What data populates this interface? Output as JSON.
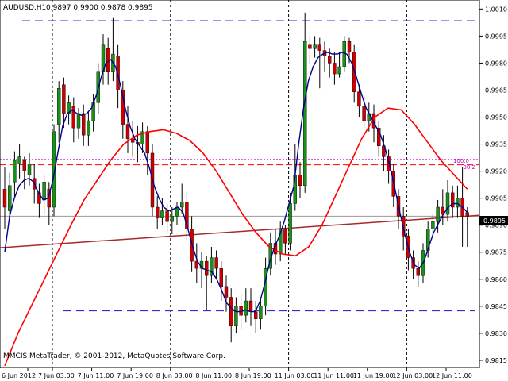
{
  "header": {
    "symbol": "AUDUSD,H1",
    "ohlc": "0.9897 0.9900 0.9878 0.9895"
  },
  "footer": {
    "copyright": "MMCIS MetaTrader, © 2001-2012, MetaQuotes Software Corp."
  },
  "colors": {
    "bull": "#1a8f1a",
    "bear": "#cc0000",
    "wick": "#000000",
    "fast_ma": "#00008b",
    "slow_ma": "#ff0000",
    "trendline": "#a52a2a",
    "channel": "#3333cc",
    "fib": "#cc00cc",
    "level": "#ff0000",
    "bid_line": "#999999",
    "grid": "#000000"
  },
  "chart_data": {
    "type": "candlestick",
    "title": "AUDUSD,H1",
    "ylim": [
      0.9811,
      1.0015
    ],
    "y_ticks": [
      "1.0010",
      "0.9995",
      "0.9980",
      "0.9965",
      "0.9950",
      "0.9935",
      "0.9920",
      "0.9905",
      "0.9890",
      "0.9875",
      "0.9860",
      "0.9845",
      "0.9830",
      "0.9815"
    ],
    "x_ticks": [
      "6 Jun 2012",
      "7 Jun 03:00",
      "7 Jun 11:00",
      "7 Jun 19:00",
      "8 Jun 03:00",
      "8 Jun 11:00",
      "8 Jun 19:00",
      "11 Jun 03:00",
      "11 Jun 11:00",
      "11 Jun 19:00",
      "12 Jun 03:00",
      "12 Jun 11:00"
    ],
    "period_separators": [
      "7 Jun 03:00",
      "8 Jun 03:00",
      "11 Jun 03:00",
      "12 Jun 03:00"
    ],
    "current_price": "0.9895",
    "fibonacci": {
      "level_100": "100.0",
      "level_38": "38.2",
      "price_100": 0.99265,
      "price_38": 0.99235
    },
    "channel_upper": 1.00035,
    "channel_lower": 0.98425,
    "candles_part1": [
      [
        0.991,
        0.99,
        0.9922,
        0.9888
      ],
      [
        0.9898,
        0.9912,
        0.9919,
        0.9893
      ],
      [
        0.9914,
        0.9926,
        0.9931,
        0.9906
      ],
      [
        0.9924,
        0.9928,
        0.9935,
        0.9916
      ],
      [
        0.9926,
        0.992,
        0.9928,
        0.991
      ],
      [
        0.9918,
        0.9924,
        0.993,
        0.9912
      ],
      [
        0.9916,
        0.991,
        0.9924,
        0.9902
      ],
      [
        0.9908,
        0.9902,
        0.9913,
        0.9894
      ],
      [
        0.9904,
        0.9914,
        0.9918,
        0.9896
      ],
      [
        0.991,
        0.99,
        0.9914,
        0.989
      ],
      [
        0.99,
        0.9942,
        0.9946,
        0.9895
      ],
      [
        0.9946,
        0.9966,
        0.997,
        0.9936
      ],
      [
        0.9968,
        0.9952,
        0.9972,
        0.9944
      ],
      [
        0.9952,
        0.9958,
        0.9962,
        0.9946
      ],
      [
        0.9956,
        0.9944,
        0.9961,
        0.9936
      ],
      [
        0.9944,
        0.9952,
        0.9955,
        0.9938
      ],
      [
        0.9952,
        0.994,
        0.9957,
        0.9934
      ],
      [
        0.994,
        0.9948,
        0.9953,
        0.9934
      ],
      [
        0.9948,
        0.9958,
        0.9963,
        0.9942
      ],
      [
        0.9958,
        0.9975,
        0.998,
        0.9952
      ],
      [
        0.9975,
        0.999,
        0.9996,
        0.9968
      ],
      [
        0.9988,
        0.9975,
        0.9994,
        0.9968
      ],
      [
        0.9975,
        0.9985,
        1.0005,
        0.997
      ],
      [
        0.9984,
        0.9965,
        0.999,
        0.9955
      ],
      [
        0.9965,
        0.9946,
        0.997,
        0.9938
      ],
      [
        0.9946,
        0.9938,
        0.9956,
        0.993
      ],
      [
        0.9938,
        0.9936,
        0.9948,
        0.9928
      ],
      [
        0.9936,
        0.9935,
        0.9945,
        0.9925
      ],
      [
        0.9935,
        0.9942,
        0.9947,
        0.993
      ],
      [
        0.9942,
        0.993,
        0.9945,
        0.9918
      ],
      [
        0.993,
        0.99,
        0.9935,
        0.9895
      ],
      [
        0.99,
        0.9894,
        0.9906,
        0.9888
      ],
      [
        0.9894,
        0.9898,
        0.9905,
        0.989
      ],
      [
        0.9898,
        0.9892,
        0.9902,
        0.9886
      ],
      [
        0.9892,
        0.9895,
        0.99,
        0.9885
      ],
      [
        0.9895,
        0.99,
        0.9903,
        0.989
      ],
      [
        0.99,
        0.9903,
        0.9913,
        0.9896
      ],
      [
        0.9903,
        0.9888,
        0.9908,
        0.9882
      ],
      [
        0.9888,
        0.987,
        0.9895,
        0.9864
      ],
      [
        0.987,
        0.9866,
        0.988,
        0.9858
      ],
      [
        0.9866,
        0.987,
        0.9875,
        0.9855
      ],
      [
        0.987,
        0.9862,
        0.9873,
        0.9843
      ],
      [
        0.9862,
        0.9872,
        0.9878,
        0.9858
      ],
      [
        0.9872,
        0.9866,
        0.9876,
        0.986
      ],
      [
        0.9866,
        0.9856,
        0.987,
        0.9848
      ],
      [
        0.9856,
        0.985,
        0.9862,
        0.9842
      ]
    ],
    "candles_part2": [
      [
        0.985,
        0.9834,
        0.9855,
        0.9825
      ],
      [
        0.9834,
        0.9845,
        0.985,
        0.983
      ],
      [
        0.9845,
        0.984,
        0.9852,
        0.9832
      ],
      [
        0.984,
        0.9848,
        0.9855,
        0.9836
      ],
      [
        0.9848,
        0.9842,
        0.9855,
        0.9834
      ],
      [
        0.9842,
        0.9838,
        0.9848,
        0.983
      ],
      [
        0.9838,
        0.9845,
        0.985,
        0.9832
      ],
      [
        0.9845,
        0.9866,
        0.9872,
        0.984
      ],
      [
        0.9866,
        0.988,
        0.9886,
        0.9862
      ],
      [
        0.988,
        0.9874,
        0.9888,
        0.9868
      ],
      [
        0.9874,
        0.9888,
        0.9892,
        0.987
      ],
      [
        0.9888,
        0.988,
        0.989,
        0.9874
      ],
      [
        0.988,
        0.9902,
        0.9908,
        0.9876
      ],
      [
        0.9902,
        0.9918,
        0.9935,
        0.9898
      ],
      [
        0.9918,
        0.9912,
        0.9925,
        0.9905
      ],
      [
        0.9912,
        0.9992,
        1.0008,
        0.9908
      ],
      [
        0.999,
        0.9988,
        0.9995,
        0.998
      ],
      [
        0.9988,
        0.999,
        0.9995,
        0.9983
      ],
      [
        0.999,
        0.9987,
        0.9994,
        0.9966
      ],
      [
        0.9987,
        0.9984,
        0.9992,
        0.9975
      ],
      [
        0.9984,
        0.998,
        0.9988,
        0.9972
      ],
      [
        0.998,
        0.9974,
        0.9986,
        0.9968
      ],
      [
        0.9974,
        0.9978,
        0.9986,
        0.9972
      ],
      [
        0.9978,
        0.9992,
        0.9995,
        0.9975
      ],
      [
        0.9992,
        0.9986,
        0.9994,
        0.998
      ],
      [
        0.9986,
        0.9964,
        0.999,
        0.9958
      ],
      [
        0.9964,
        0.9956,
        0.9968,
        0.995
      ],
      [
        0.9956,
        0.9948,
        0.9962,
        0.9944
      ],
      [
        0.9948,
        0.9952,
        0.9958,
        0.9942
      ],
      [
        0.9952,
        0.9944,
        0.9957,
        0.9936
      ],
      [
        0.9944,
        0.9934,
        0.9948,
        0.9928
      ],
      [
        0.9934,
        0.9928,
        0.994,
        0.992
      ],
      [
        0.9928,
        0.992,
        0.9932,
        0.9913
      ],
      [
        0.992,
        0.9906,
        0.9924,
        0.99
      ],
      [
        0.9906,
        0.9895,
        0.991,
        0.9888
      ],
      [
        0.9895,
        0.9884,
        0.99,
        0.9876
      ],
      [
        0.9884,
        0.9872,
        0.9888,
        0.9865
      ],
      [
        0.9872,
        0.9866,
        0.9876,
        0.986
      ],
      [
        0.9866,
        0.9862,
        0.987,
        0.9856
      ],
      [
        0.9862,
        0.9876,
        0.988,
        0.9858
      ],
      [
        0.9876,
        0.9888,
        0.9892,
        0.9872
      ],
      [
        0.9888,
        0.9892,
        0.9896,
        0.9882
      ],
      [
        0.9892,
        0.99,
        0.9904,
        0.9886
      ],
      [
        0.99,
        0.9896,
        0.991,
        0.989
      ],
      [
        0.9896,
        0.9908,
        0.9915,
        0.9892
      ],
      [
        0.9908,
        0.99,
        0.9912,
        0.9894
      ],
      [
        0.99,
        0.9905,
        0.9912,
        0.9894
      ],
      [
        0.9905,
        0.9895,
        0.9922,
        0.9878
      ],
      [
        0.9897,
        0.9895,
        0.99,
        0.9878
      ]
    ],
    "fast_ma": [
      0.9875,
      0.9895,
      0.9905,
      0.9912,
      0.9915,
      0.9916,
      0.9914,
      0.9908,
      0.9904,
      0.9905,
      0.9915,
      0.993,
      0.9945,
      0.9952,
      0.9954,
      0.9952,
      0.9951,
      0.9952,
      0.9955,
      0.9962,
      0.9972,
      0.998,
      0.9982,
      0.9978,
      0.9968,
      0.9955,
      0.9945,
      0.9938,
      0.9934,
      0.993,
      0.9922,
      0.9912,
      0.9905,
      0.99,
      0.9898,
      0.9899,
      0.99,
      0.9897,
      0.9888,
      0.9878,
      0.987,
      0.9866,
      0.9865,
      0.9864,
      0.986,
      0.9854,
      0.9847,
      0.9844,
      0.9842,
      0.9842,
      0.9843,
      0.9842,
      0.9842,
      0.9848,
      0.9858,
      0.987,
      0.9878,
      0.9884,
      0.9892,
      0.9902,
      0.9912,
      0.9935,
      0.9955,
      0.997,
      0.9978,
      0.9983,
      0.9985,
      0.9986,
      0.9985,
      0.9985,
      0.9986,
      0.9985,
      0.998,
      0.9972,
      0.9963,
      0.9955,
      0.995,
      0.9945,
      0.994,
      0.9932,
      0.9922,
      0.991,
      0.9897,
      0.9885,
      0.9875,
      0.9868,
      0.9866,
      0.987,
      0.9878,
      0.9886,
      0.9891,
      0.9896,
      0.99,
      0.9902,
      0.9902,
      0.99,
      0.9897
    ],
    "slow_ma": [
      0.9812,
      0.983,
      0.9845,
      0.986,
      0.9875,
      0.989,
      0.9904,
      0.9915,
      0.9926,
      0.9935,
      0.994,
      0.9942,
      0.9943,
      0.9941,
      0.9937,
      0.993,
      0.992,
      0.9908,
      0.9896,
      0.9886,
      0.9878,
      0.9874,
      0.9873,
      0.9878,
      0.989,
      0.9906,
      0.9922,
      0.9938,
      0.995,
      0.9955,
      0.9954,
      0.9946,
      0.9936,
      0.9926,
      0.9918,
      0.991
    ],
    "trendline": [
      0.98775,
      0.98955
    ]
  }
}
